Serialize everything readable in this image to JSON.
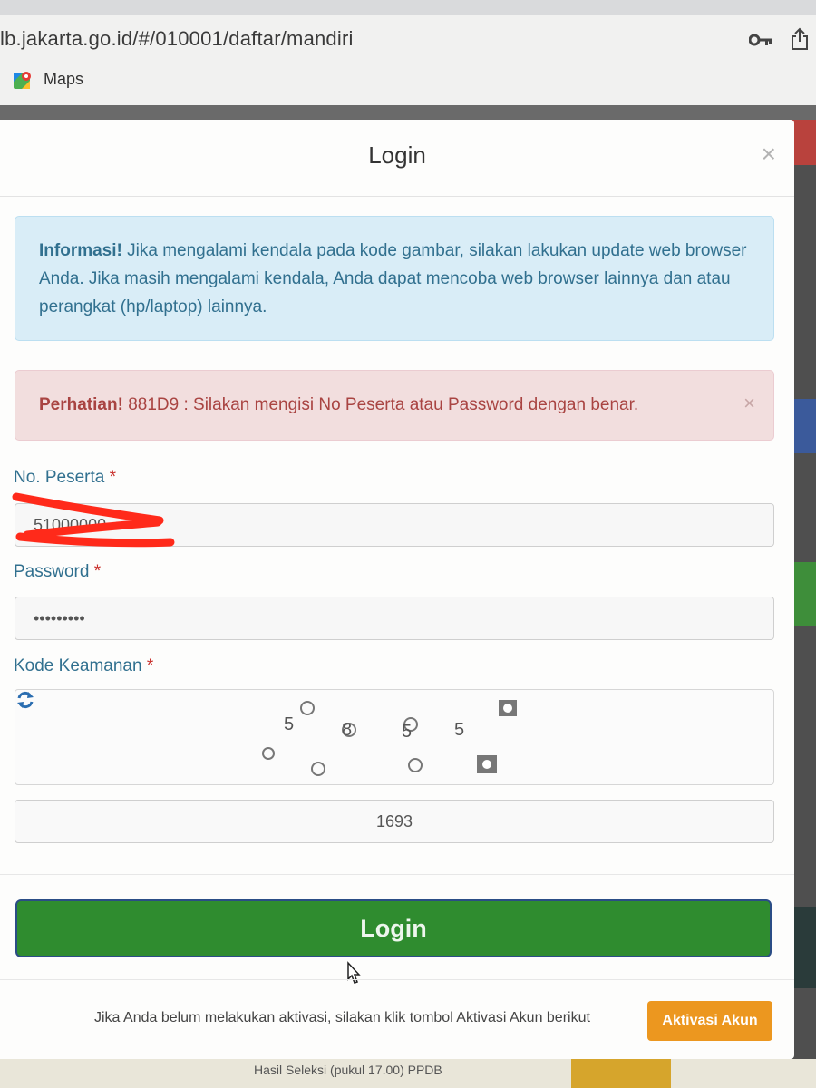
{
  "browser": {
    "url": "lb.jakarta.go.id/#/010001/daftar/mandiri",
    "bookmarks": [
      {
        "label": "Maps",
        "icon": "maps-icon"
      }
    ]
  },
  "background": {
    "footer_text": "Hasil Seleksi (pukul 17.00) PPDB"
  },
  "modal": {
    "title": "Login",
    "close_symbol": "×",
    "info_alert": {
      "strong": "Informasi!",
      "text": " Jika mengalami kendala pada kode gambar, silakan lakukan update web browser Anda. Jika masih mengalami kendala, Anda dapat mencoba web browser lainnya dan atau perangkat (hp/laptop) lainnya."
    },
    "error_alert": {
      "strong": "Perhatian!",
      "text": " 881D9 : Silakan mengisi No Peserta atau Password dengan benar.",
      "close_symbol": "×"
    },
    "fields": {
      "no_peserta": {
        "label": "No. Peserta",
        "required_mark": "*",
        "value": "51000000"
      },
      "password": {
        "label": "Password",
        "required_mark": "*",
        "value": "•••••••••"
      },
      "kode_keamanan": {
        "label": "Kode Keamanan",
        "required_mark": "*",
        "answer": "1693"
      }
    },
    "captcha": {
      "chars": [
        "5",
        "8",
        "5",
        "5"
      ]
    },
    "login_button": "Login",
    "footer": {
      "text": "Jika Anda belum melakukan aktivasi, silakan klik tombol Aktivasi Akun berikut",
      "activate_button": "Aktivasi Akun"
    }
  },
  "colors": {
    "info_bg": "#d9edf7",
    "danger_bg": "#f2dede",
    "login_green": "#2f8c2f",
    "activate_orange": "#ec971f",
    "redaction_red": "#ff2a1a"
  }
}
